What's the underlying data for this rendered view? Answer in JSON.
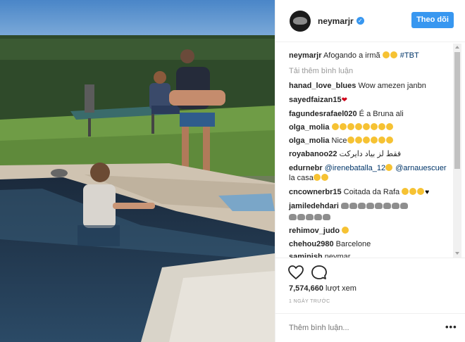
{
  "post": {
    "username": "neymarjr",
    "verified_icon": "verified-badge-icon",
    "follow_label": "Theo dõi"
  },
  "caption": {
    "username": "neymarjr",
    "text": "Afogando a irmã",
    "hashtag": "#TBT"
  },
  "load_more_label": "Tải thêm bình luận",
  "comments": [
    {
      "user": "hanad_love_blues",
      "text": "Wow amezen janbn"
    },
    {
      "user": "sayedfaizan15",
      "text": ""
    },
    {
      "user": "fagundesrafael020",
      "text": "É a Bruna ali"
    },
    {
      "user": "olga_molia",
      "text": ""
    },
    {
      "user": "olga_molia",
      "text": "Nice"
    },
    {
      "user": "royabanoo22",
      "text": "فقط لز بیاد دایرکت"
    },
    {
      "user": "edurnebr",
      "mention1": "@irenebatalla_12",
      "mention2": "@arnauescuer",
      "text2": "la casa"
    },
    {
      "user": "cncownerbr15",
      "text": "Coitada da Rafa"
    },
    {
      "user": "jamiledehdari",
      "text": ""
    },
    {
      "user": "rehimov_judo",
      "text": ""
    },
    {
      "user": "chehou2980",
      "text": "Barcelone"
    },
    {
      "user": "saminish",
      "text": "neymar"
    }
  ],
  "actions": {
    "like_icon": "heart-icon",
    "comment_icon": "comment-bubble-icon",
    "views_count": "7,574,660",
    "views_label": "lượt xem",
    "time_ago": "1 NGÀY TRƯỚC",
    "add_comment_placeholder": "Thêm bình luận...",
    "more_icon": "more-options-icon",
    "more_label": "•••"
  },
  "colors": {
    "accent": "#3897f0",
    "text": "#262626",
    "muted": "#999999",
    "link": "#003569"
  }
}
